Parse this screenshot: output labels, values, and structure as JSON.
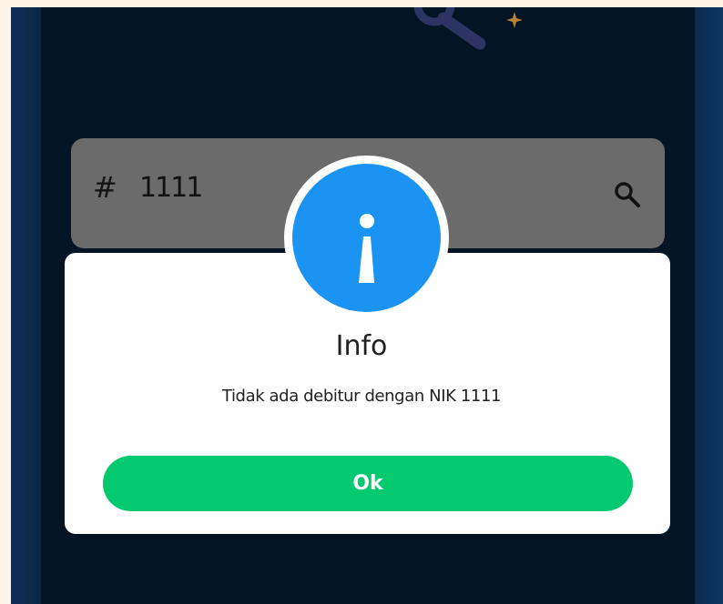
{
  "search": {
    "prefix_icon": "hash-icon",
    "prefix_glyph": "#",
    "value": "1111",
    "action_icon": "search-icon"
  },
  "dialog": {
    "icon": "info-icon",
    "title": "Info",
    "message": "Tidak ada debitur dengan NIK 1111",
    "ok_label": "Ok"
  },
  "colors": {
    "page_background": "#fdf4e7",
    "screen_background": "#031425",
    "search_background": "#6b6b6b",
    "dialog_background": "#ffffff",
    "info_blue": "#1b93f3",
    "ok_green": "#05c96e"
  }
}
